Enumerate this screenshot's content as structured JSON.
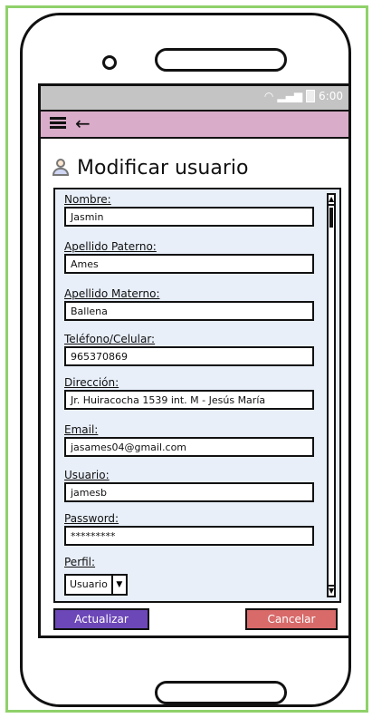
{
  "status_bar": {
    "time": "6:00"
  },
  "header": {
    "title": "Modificar usuario"
  },
  "form": {
    "fields": [
      {
        "label": "Nombre:",
        "value": "Jasmin"
      },
      {
        "label": "Apellido Paterno:",
        "value": "Ames"
      },
      {
        "label": "Apellido Materno:",
        "value": "Ballena"
      },
      {
        "label": "Teléfono/Celular:",
        "value": "965370869"
      },
      {
        "label": "Dirección:",
        "value": "Jr. Huiracocha 1539 int. M - Jesús María"
      },
      {
        "label": "Email:",
        "value": "jasames04@gmail.com"
      },
      {
        "label": "Usuario:",
        "value": "jamesb"
      },
      {
        "label": "Password:",
        "value": "*********"
      }
    ],
    "perfil": {
      "label": "Perfil:",
      "value": "Usuario"
    }
  },
  "actions": {
    "update_label": "Actualizar",
    "cancel_label": "Cancelar"
  },
  "colors": {
    "frame": "#8fd16a",
    "appbar": "#d9acc9",
    "update": "#6c47b8",
    "cancel": "#d86a6a",
    "panel": "#e8eff9"
  }
}
